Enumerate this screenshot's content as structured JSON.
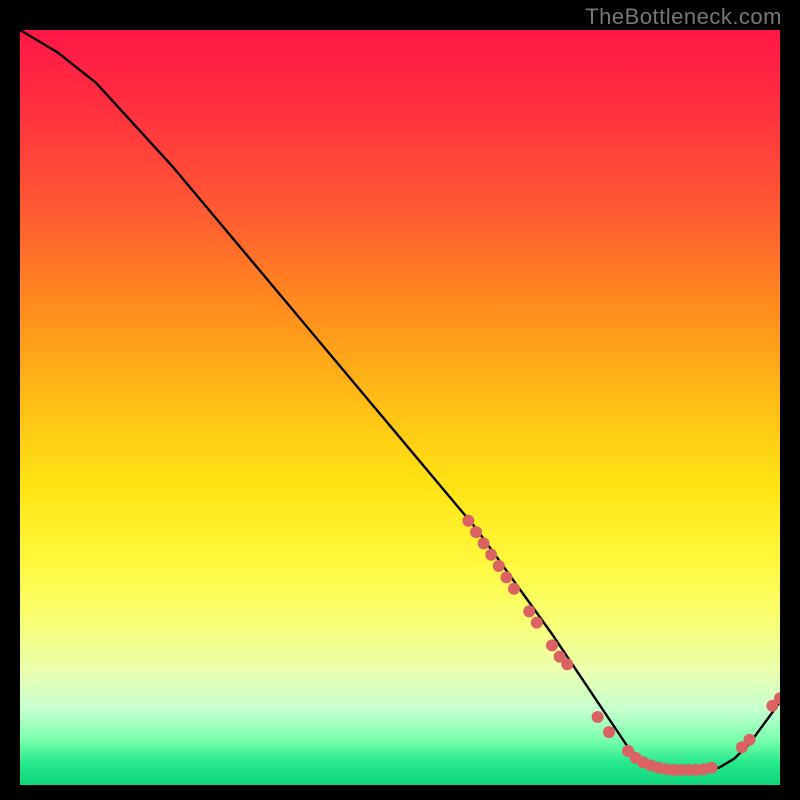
{
  "watermark": "TheBottleneck.com",
  "chart_data": {
    "type": "line",
    "title": "",
    "xlabel": "",
    "ylabel": "",
    "xlim": [
      0,
      100
    ],
    "ylim": [
      0,
      100
    ],
    "grid": false,
    "legend": false,
    "series": [
      {
        "name": "curve",
        "x": [
          0,
          5,
          10,
          20,
          30,
          40,
          50,
          60,
          65,
          70,
          74,
          76,
          78,
          80,
          82,
          84,
          86,
          88,
          90,
          92,
          94,
          96,
          100
        ],
        "y": [
          100,
          97,
          93,
          82,
          70,
          58,
          46,
          34,
          27,
          20,
          14,
          11,
          8,
          5,
          3.1,
          2.4,
          2.2,
          2.1,
          2.1,
          2.3,
          3.5,
          5.5,
          11
        ]
      }
    ],
    "highlight_dots": [
      {
        "name": "cluster-descent",
        "points": [
          {
            "x": 59,
            "y": 35
          },
          {
            "x": 60,
            "y": 33.5
          },
          {
            "x": 61,
            "y": 32
          },
          {
            "x": 62,
            "y": 30.5
          },
          {
            "x": 63,
            "y": 29
          },
          {
            "x": 64,
            "y": 27.5
          },
          {
            "x": 65,
            "y": 26
          },
          {
            "x": 67,
            "y": 23
          },
          {
            "x": 68,
            "y": 21.5
          },
          {
            "x": 70,
            "y": 18.5
          },
          {
            "x": 71,
            "y": 17
          },
          {
            "x": 72,
            "y": 16
          }
        ]
      },
      {
        "name": "cluster-valley",
        "points": [
          {
            "x": 76,
            "y": 9
          },
          {
            "x": 77.5,
            "y": 7
          },
          {
            "x": 80,
            "y": 4.5
          },
          {
            "x": 81,
            "y": 3.6
          },
          {
            "x": 82,
            "y": 3.0
          },
          {
            "x": 83,
            "y": 2.6
          },
          {
            "x": 84,
            "y": 2.3
          },
          {
            "x": 85,
            "y": 2.1
          },
          {
            "x": 86,
            "y": 2.0
          },
          {
            "x": 87,
            "y": 2.0
          },
          {
            "x": 88,
            "y": 2.0
          },
          {
            "x": 89,
            "y": 2.0
          },
          {
            "x": 90,
            "y": 2.1
          },
          {
            "x": 91,
            "y": 2.3
          }
        ]
      },
      {
        "name": "cluster-ascent",
        "points": [
          {
            "x": 95,
            "y": 5.0
          },
          {
            "x": 96,
            "y": 6.0
          },
          {
            "x": 99,
            "y": 10.5
          },
          {
            "x": 100,
            "y": 11.5
          }
        ]
      }
    ],
    "dot_radius_px": 6
  }
}
